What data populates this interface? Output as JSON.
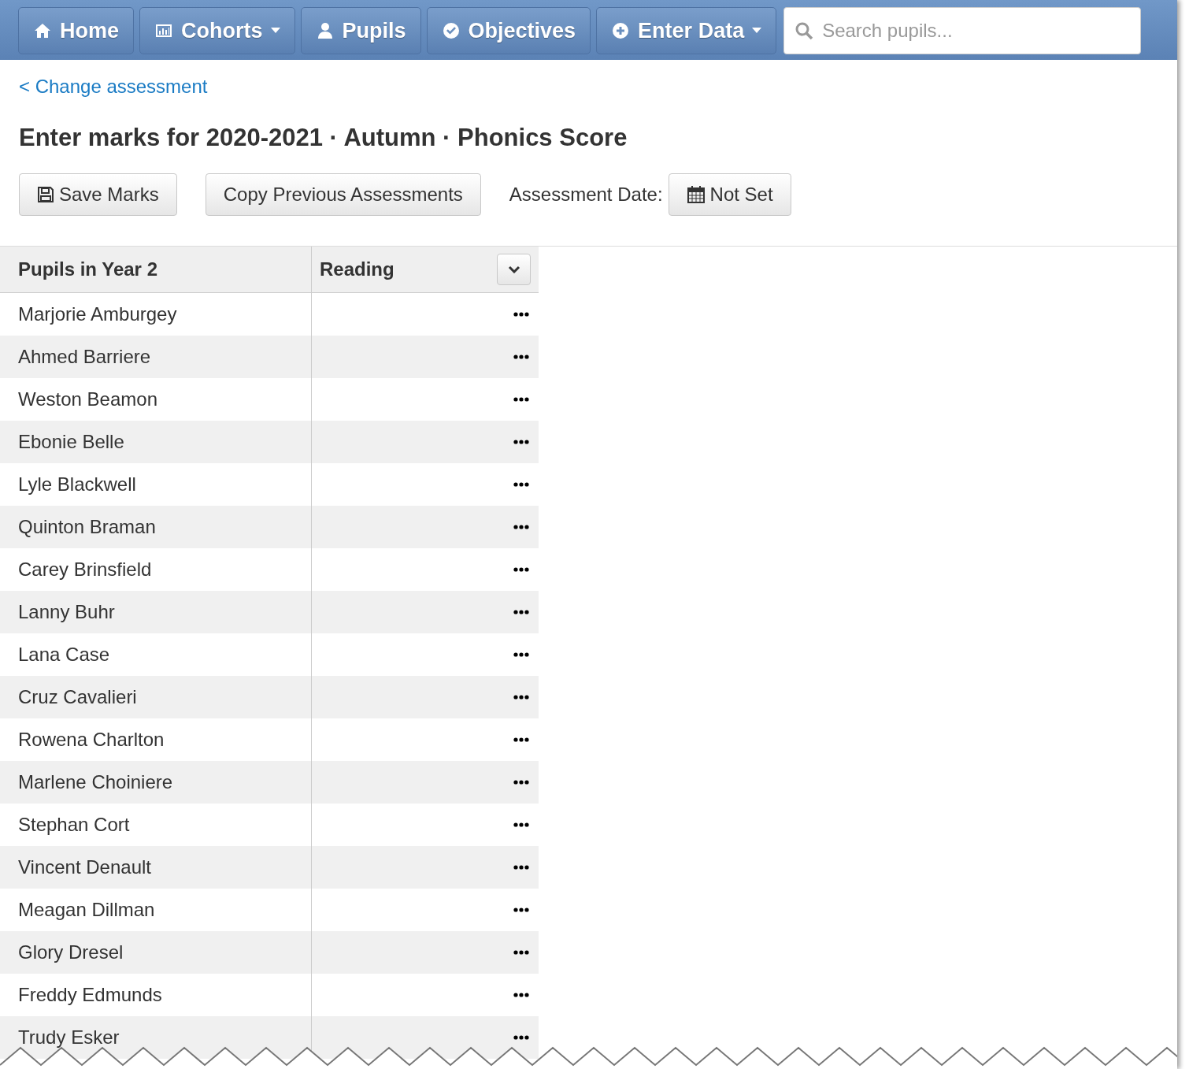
{
  "nav": {
    "items": [
      {
        "label": "Home",
        "dropdown": false
      },
      {
        "label": "Cohorts",
        "dropdown": true
      },
      {
        "label": "Pupils",
        "dropdown": false
      },
      {
        "label": "Objectives",
        "dropdown": false
      },
      {
        "label": "Enter Data",
        "dropdown": true
      }
    ],
    "search": {
      "placeholder": "Search pupils..."
    }
  },
  "back_link": "< Change assessment",
  "title": "Enter marks for 2020-2021 · Autumn · Phonics Score",
  "toolbar": {
    "save": "Save Marks",
    "copy": "Copy Previous Assessments",
    "date_label": "Assessment Date:",
    "date_value": "Not Set"
  },
  "table": {
    "columns": [
      "Pupils in Year 2",
      "Reading"
    ],
    "rows": [
      "Marjorie Amburgey",
      "Ahmed Barriere",
      "Weston Beamon",
      "Ebonie Belle",
      "Lyle Blackwell",
      "Quinton Braman",
      "Carey Brinsfield",
      "Lanny Buhr",
      "Lana Case",
      "Cruz Cavalieri",
      "Rowena Charlton",
      "Marlene Choiniere",
      "Stephan Cort",
      "Vincent Denault",
      "Meagan Dillman",
      "Glory Dresel",
      "Freddy Edmunds",
      "Trudy Esker"
    ]
  }
}
